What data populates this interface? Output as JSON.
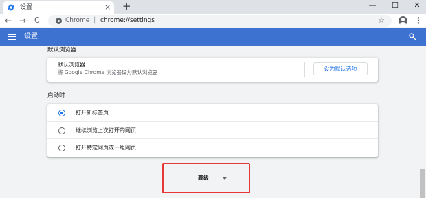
{
  "tab": {
    "title": "设置",
    "close": "×"
  },
  "new_tab": "+",
  "window": {
    "minimize": "—",
    "maximize": "☐",
    "close": "✕"
  },
  "toolbar": {
    "back": "←",
    "forward": "→",
    "reload": "C",
    "site_label": "Chrome",
    "separator": "|",
    "url": "chrome://settings",
    "bookmark": "☆",
    "menu": "⋮"
  },
  "header": {
    "title": "设置"
  },
  "default_browser": {
    "section_title": "默认浏览器",
    "primary": "默认浏览器",
    "secondary": "将 Google Chrome 浏览器设为默认浏览器",
    "button_label": "设为默认选项"
  },
  "startup": {
    "section_title": "启动时",
    "options": [
      {
        "label": "打开新标签页",
        "selected": true
      },
      {
        "label": "继续浏览上次打开的网页",
        "selected": false
      },
      {
        "label": "打开特定网页或一组网页",
        "selected": false
      }
    ]
  },
  "advanced": {
    "label": "高级"
  },
  "colors": {
    "header": "#3d72d1",
    "accent": "#1a73e8",
    "highlight_border": "#e53935"
  },
  "icons": [
    "settings-icon",
    "menu-icon",
    "search-icon",
    "star-icon",
    "profile-icon",
    "kebab-icon",
    "caret-down-icon"
  ]
}
